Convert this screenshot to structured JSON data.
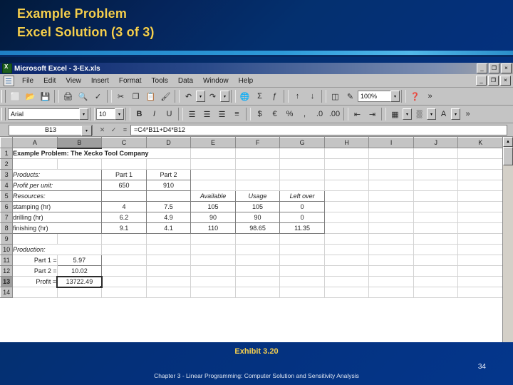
{
  "slide": {
    "title_lines": [
      "Example Problem",
      "Excel Solution (3 of 3)"
    ],
    "exhibit": "Exhibit 3.20",
    "chapter": "Chapter 3 - Linear Programming:  Computer Solution and Sensitivity Analysis",
    "page_number": "34",
    "accent_color": "#f5cf4e",
    "background_color": "#043a8e",
    "rule_color": "#2e9ad8"
  },
  "excel": {
    "title": "Microsoft Excel - 3-Ex.xls",
    "window_buttons": [
      "_",
      "❐",
      "×"
    ],
    "menu": [
      {
        "label": "File"
      },
      {
        "label": "Edit"
      },
      {
        "label": "View"
      },
      {
        "label": "Insert"
      },
      {
        "label": "Format"
      },
      {
        "label": "Tools"
      },
      {
        "label": "Data"
      },
      {
        "label": "Window"
      },
      {
        "label": "Help"
      }
    ],
    "standard_toolbar": [
      {
        "name": "new-icon",
        "glyph": "⬜"
      },
      {
        "name": "open-icon",
        "glyph": "📂"
      },
      {
        "name": "save-icon",
        "glyph": "💾"
      },
      {
        "name": "print-icon",
        "glyph": "🖨"
      },
      {
        "name": "print-preview-icon",
        "glyph": "🔍"
      },
      {
        "name": "spelling-icon",
        "glyph": "✓"
      },
      {
        "name": "cut-icon",
        "glyph": "✂"
      },
      {
        "name": "copy-icon",
        "glyph": "❐"
      },
      {
        "name": "paste-icon",
        "glyph": "📋"
      },
      {
        "name": "format-painter-icon",
        "glyph": "🖌"
      },
      {
        "name": "undo-icon",
        "glyph": "↶"
      },
      {
        "name": "redo-icon",
        "glyph": "↷"
      },
      {
        "name": "hyperlink-icon",
        "glyph": "🌐"
      },
      {
        "name": "autosum-icon",
        "glyph": "Σ"
      },
      {
        "name": "function-wizard-icon",
        "glyph": "ƒ"
      },
      {
        "name": "sort-ascending-icon",
        "glyph": "↑"
      },
      {
        "name": "sort-descending-icon",
        "glyph": "↓"
      },
      {
        "name": "chart-wizard-icon",
        "glyph": "◫"
      },
      {
        "name": "drawing-icon",
        "glyph": "✎"
      },
      {
        "name": "help-assistant-icon",
        "glyph": "❓"
      }
    ],
    "zoom_value": "100%",
    "formatting_toolbar": {
      "font_name": "Arial",
      "font_size": "10",
      "buttons": [
        {
          "name": "bold-icon",
          "glyph": "B"
        },
        {
          "name": "italic-icon",
          "glyph": "I"
        },
        {
          "name": "underline-icon",
          "glyph": "U"
        },
        {
          "name": "align-left-icon",
          "glyph": "☰"
        },
        {
          "name": "align-center-icon",
          "glyph": "☰"
        },
        {
          "name": "align-right-icon",
          "glyph": "☰"
        },
        {
          "name": "merge-center-icon",
          "glyph": "≡"
        },
        {
          "name": "currency-icon",
          "glyph": "$"
        },
        {
          "name": "euro-icon",
          "glyph": "€"
        },
        {
          "name": "percent-icon",
          "glyph": "%"
        },
        {
          "name": "comma-icon",
          "glyph": ","
        },
        {
          "name": "increase-decimal-icon",
          "glyph": ".0"
        },
        {
          "name": "decrease-decimal-icon",
          "glyph": ".00"
        },
        {
          "name": "decrease-indent-icon",
          "glyph": "⇤"
        },
        {
          "name": "increase-indent-icon",
          "glyph": "⇥"
        },
        {
          "name": "borders-icon",
          "glyph": "▦"
        },
        {
          "name": "fill-color-icon",
          "glyph": "▒"
        },
        {
          "name": "font-color-icon",
          "glyph": "A"
        }
      ]
    },
    "formula_bar": {
      "name_box": "B13",
      "cancel_glyph": "✕",
      "accept_glyph": "✓",
      "function_glyph": "=",
      "formula": "=C4*B11+D4*B12"
    },
    "sheet": {
      "columns": [
        "A",
        "B",
        "C",
        "D",
        "E",
        "F",
        "G",
        "H",
        "I",
        "J",
        "K"
      ],
      "selected_column": "B",
      "selected_row": "13",
      "selected_cell": "B13",
      "rows": [
        {
          "n": "1",
          "cells": [
            {
              "c": "A",
              "v": "Example Problem:  The Xecko Tool Company",
              "style": "bold t-left",
              "span": 4
            }
          ]
        },
        {
          "n": "2",
          "cells": []
        },
        {
          "n": "3",
          "cells": [
            {
              "c": "A",
              "v": "Products:",
              "style": "ital t-left bx",
              "span": 2
            },
            {
              "c": "C",
              "v": "Part 1",
              "style": "t-center bx"
            },
            {
              "c": "D",
              "v": "Part 2",
              "style": "t-center bx"
            }
          ]
        },
        {
          "n": "4",
          "cells": [
            {
              "c": "A",
              "v": "Profit per unit:",
              "style": "ital t-left bx",
              "span": 2
            },
            {
              "c": "C",
              "v": "650",
              "style": "t-center bx"
            },
            {
              "c": "D",
              "v": "910",
              "style": "t-center bx"
            }
          ]
        },
        {
          "n": "5",
          "cells": [
            {
              "c": "A",
              "v": "Resources:",
              "style": "ital t-left bx",
              "span": 2
            },
            {
              "c": "C",
              "v": "",
              "style": "bx"
            },
            {
              "c": "D",
              "v": "",
              "style": "bx"
            },
            {
              "c": "E",
              "v": "Available",
              "style": "ital t-center bx"
            },
            {
              "c": "F",
              "v": "Usage",
              "style": "ital t-center bx"
            },
            {
              "c": "G",
              "v": "Left over",
              "style": "ital t-center bx"
            }
          ]
        },
        {
          "n": "6",
          "cells": [
            {
              "c": "A",
              "v": "stamping (hr)",
              "style": "t-left bx",
              "span": 2
            },
            {
              "c": "C",
              "v": "4",
              "style": "t-center bx"
            },
            {
              "c": "D",
              "v": "7.5",
              "style": "t-center bx"
            },
            {
              "c": "E",
              "v": "105",
              "style": "t-center bx"
            },
            {
              "c": "F",
              "v": "105",
              "style": "t-center bx"
            },
            {
              "c": "G",
              "v": "0",
              "style": "t-center bx"
            }
          ]
        },
        {
          "n": "7",
          "cells": [
            {
              "c": "A",
              "v": "drilling (hr)",
              "style": "t-left bx",
              "span": 2
            },
            {
              "c": "C",
              "v": "6.2",
              "style": "t-center bx"
            },
            {
              "c": "D",
              "v": "4.9",
              "style": "t-center bx"
            },
            {
              "c": "E",
              "v": "90",
              "style": "t-center bx"
            },
            {
              "c": "F",
              "v": "90",
              "style": "t-center bx"
            },
            {
              "c": "G",
              "v": "0",
              "style": "t-center bx"
            }
          ]
        },
        {
          "n": "8",
          "cells": [
            {
              "c": "A",
              "v": "finishing (hr)",
              "style": "t-left bx",
              "span": 2
            },
            {
              "c": "C",
              "v": "9.1",
              "style": "t-center bx"
            },
            {
              "c": "D",
              "v": "4.1",
              "style": "t-center bx"
            },
            {
              "c": "E",
              "v": "110",
              "style": "t-center bx"
            },
            {
              "c": "F",
              "v": "98.65",
              "style": "t-center bx"
            },
            {
              "c": "G",
              "v": "11.35",
              "style": "t-center bx"
            }
          ]
        },
        {
          "n": "9",
          "cells": []
        },
        {
          "n": "10",
          "cells": [
            {
              "c": "A",
              "v": "Production:",
              "style": "ital t-left",
              "span": 2
            }
          ]
        },
        {
          "n": "11",
          "cells": [
            {
              "c": "A",
              "v": "Part 1 =",
              "style": "t-right"
            },
            {
              "c": "B",
              "v": "5.97",
              "style": "t-center bx"
            }
          ]
        },
        {
          "n": "12",
          "cells": [
            {
              "c": "A",
              "v": "Part 2 =",
              "style": "t-right"
            },
            {
              "c": "B",
              "v": "10.02",
              "style": "t-center bx"
            }
          ]
        },
        {
          "n": "13",
          "cells": [
            {
              "c": "A",
              "v": "Profit =",
              "style": "t-right"
            },
            {
              "c": "B",
              "v": "13722.49",
              "style": "t-center selcell"
            }
          ]
        },
        {
          "n": "14",
          "cells": []
        }
      ]
    },
    "scrollbar": {
      "up_glyph": "▲",
      "down_glyph": "▼"
    }
  }
}
